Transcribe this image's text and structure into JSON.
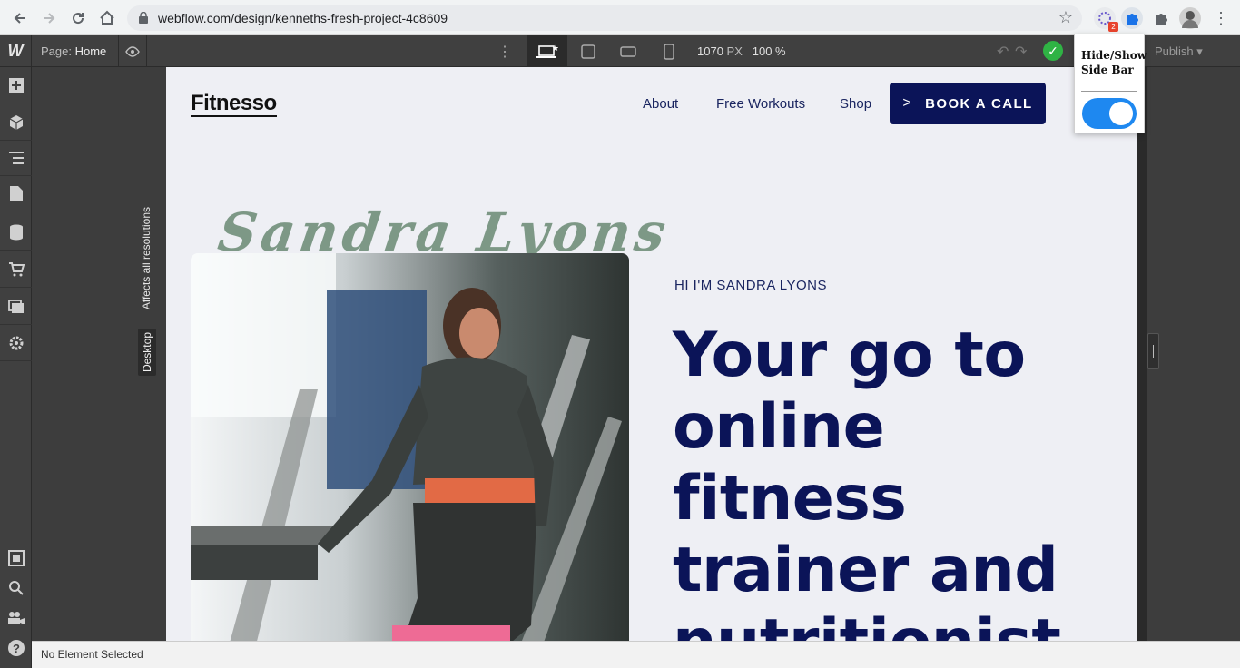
{
  "browser": {
    "url": "webflow.com/design/kenneths-fresh-project-4c8609",
    "extension_badge": "2"
  },
  "designer": {
    "page_label": "Page:",
    "page_name": "Home",
    "width_value": "1070",
    "width_unit": "PX",
    "zoom": "100 %",
    "publish_label": "Publish",
    "breakpoint_label": "Desktop",
    "breakpoint_note": "Affects all resolutions",
    "status_text": "No Element Selected"
  },
  "popup": {
    "title": "Hide/Show Side Bar",
    "toggle_on": true,
    "toggle_color": "#1e88f0"
  },
  "site": {
    "logo": "Fitnesso",
    "nav": [
      "About",
      "Free Workouts",
      "Shop"
    ],
    "cta": "BOOK A CALL",
    "signature": "Sandra Lyons",
    "intro": "HI I'M SANDRA LYONS",
    "headline": "Your go to online fitness trainer and nutritionist.",
    "colors": {
      "navy": "#0b1458",
      "background": "#eeeff4",
      "signature": "#7d9886"
    }
  }
}
